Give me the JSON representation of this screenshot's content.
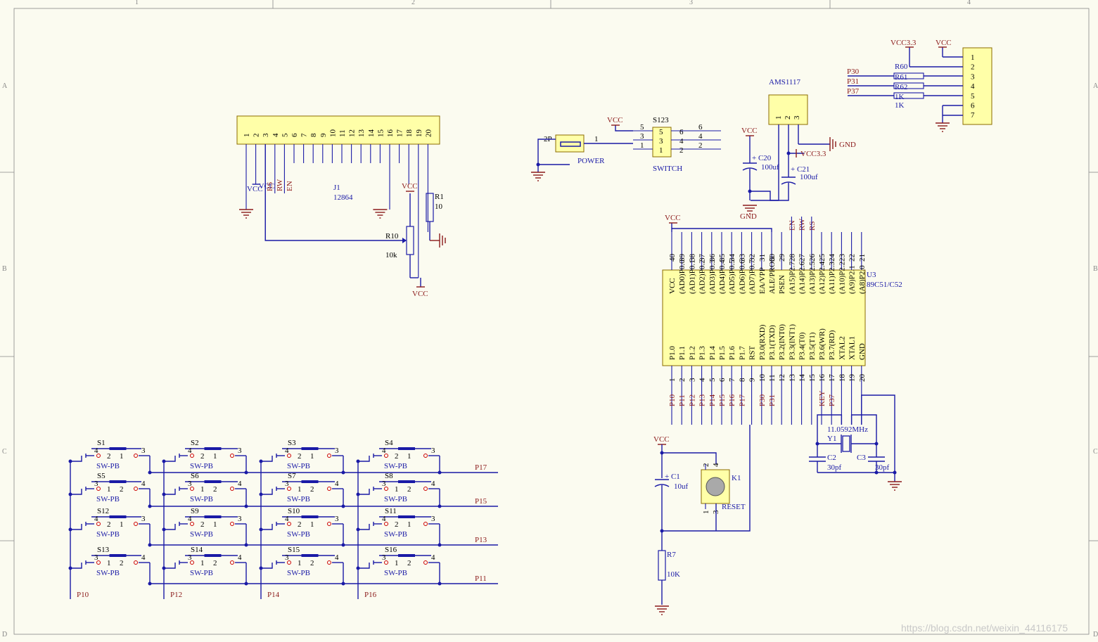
{
  "frame": {
    "cols": [
      "1",
      "2",
      "3",
      "4"
    ],
    "rows": [
      "A",
      "B",
      "C",
      "D"
    ]
  },
  "watermark": "https://blog.csdn.net/weixin_44116175",
  "lcd": {
    "ref": "J1",
    "value": "12864",
    "pins": [
      "1",
      "2",
      "3",
      "4",
      "5",
      "6",
      "7",
      "8",
      "9",
      "10",
      "11",
      "12",
      "13",
      "14",
      "15",
      "16",
      "17",
      "18",
      "19",
      "20"
    ],
    "nets": [
      "VCC",
      "RS",
      "RW",
      "EN"
    ]
  },
  "pot": {
    "ref": "R10",
    "value": "10k"
  },
  "r1": {
    "ref": "R1",
    "value": "10"
  },
  "mcu": {
    "ref": "U3",
    "value": "89C51/C52",
    "top_pins": [
      "40",
      "39",
      "38",
      "37",
      "36",
      "35",
      "34",
      "33",
      "32",
      "31",
      "30",
      "29",
      "28",
      "27",
      "26",
      "25",
      "24",
      "23",
      "22",
      "21"
    ],
    "top_names": [
      "VCC",
      "(AD0)P0.0",
      "(AD1)P0.1",
      "(AD2)P0.2",
      "(AD3)P0.3",
      "(AD4)P0.4",
      "(AD5)P0.5",
      "(AD6)P0.6",
      "(AD7)P0.7",
      "EA/VPP",
      "ALE/PROG",
      "PSEN",
      "(A15)P2.7",
      "(A14)P2.6",
      "(A13)P2.5",
      "(A12)P2.4",
      "(A11)P2.3",
      "(A10)P2.2",
      "(A9)P2.1",
      "(A8)P2.0"
    ],
    "bot_pins": [
      "1",
      "2",
      "3",
      "4",
      "5",
      "6",
      "7",
      "8",
      "9",
      "10",
      "11",
      "12",
      "13",
      "14",
      "15",
      "16",
      "17",
      "18",
      "19",
      "20"
    ],
    "bot_names": [
      "P1.0",
      "P1.1",
      "P1.2",
      "P1.3",
      "P1.4",
      "P1.5",
      "P1.6",
      "P1.7",
      "RST",
      "P3.0(RXD)",
      "P3.1(TXD)",
      "P3.2(INT0)",
      "P3.3(INT1)",
      "P3.4(T0)",
      "P3.5(T1)",
      "P3.6(WR)",
      "P3.7(RD)",
      "XTAL2",
      "XTAL1",
      "GND"
    ],
    "bot_nets": [
      "P10",
      "P11",
      "P12",
      "P13",
      "P14",
      "P15",
      "P16",
      "P17",
      "",
      "P30",
      "P31",
      "",
      "",
      "",
      "",
      "KEY",
      "P37",
      "",
      "",
      ""
    ],
    "top_nets": {
      "28": "EN",
      "27": "RW",
      "26": "RS"
    }
  },
  "power": {
    "jack": "P",
    "jack_pins": [
      "2",
      "1"
    ],
    "jack_label": "POWER",
    "switch": "S123",
    "switch_label": "SWITCH",
    "switch_pins": [
      "5",
      "3",
      "1",
      "6",
      "4",
      "2"
    ]
  },
  "reg": {
    "ref": "AMS1117",
    "pins": [
      "1",
      "2",
      "3"
    ],
    "c20": "C20",
    "c20v": "100uf",
    "c21": "C21",
    "c21v": "100uf"
  },
  "header": {
    "pins": [
      "1",
      "2",
      "3",
      "4",
      "5",
      "6",
      "7"
    ],
    "r60": "R60",
    "r61": "R61",
    "r62": "R62",
    "r1k": "1K",
    "nets": [
      "P30",
      "P31",
      "P37"
    ],
    "vcc33": "VCC3.3",
    "vcc": "VCC"
  },
  "reset": {
    "c1": "C1",
    "c1v": "10uf",
    "k1": "K1",
    "k1l": "RESET",
    "r7": "R7",
    "r7v": "10K",
    "kpins": [
      "2",
      "4",
      "1",
      "3"
    ]
  },
  "xtal": {
    "y1": "Y1",
    "y1v": "11.0592MHz",
    "c2": "C2",
    "c3": "C3",
    "cv": "30pf"
  },
  "labels": {
    "vcc": "VCC",
    "vcc33": "VCC3.3",
    "gnd": "GND",
    "plus": "+"
  },
  "keypad": {
    "switches": [
      "S1",
      "S2",
      "S3",
      "S4",
      "S5",
      "S6",
      "S7",
      "S8",
      "S12",
      "S9",
      "S10",
      "S11",
      "S13",
      "S14",
      "S15",
      "S16"
    ],
    "type": "SW-PB",
    "rows": [
      "P17",
      "P15",
      "P13",
      "P11"
    ],
    "cols": [
      "P10",
      "P12",
      "P14",
      "P16"
    ]
  }
}
